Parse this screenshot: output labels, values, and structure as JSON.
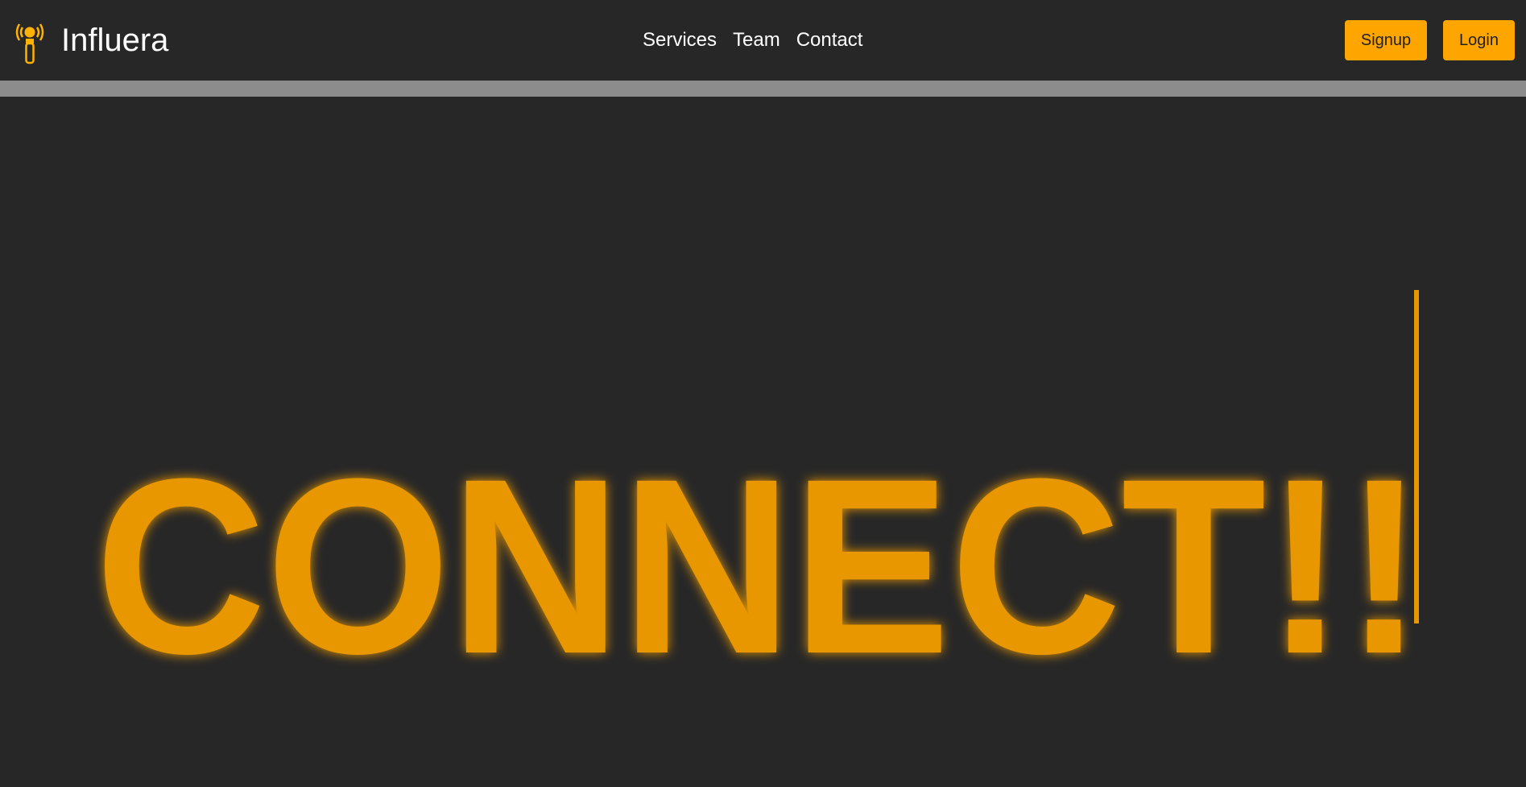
{
  "brand": {
    "name": "Influera",
    "icon": "signal-tower-icon"
  },
  "nav": {
    "links": [
      "Services",
      "Team",
      "Contact"
    ]
  },
  "auth": {
    "signup_label": "Signup",
    "login_label": "Login"
  },
  "hero": {
    "headline": "CONNECT!!"
  },
  "colors": {
    "background": "#272727",
    "accent": "#ffa500",
    "headline": "#e89700",
    "divider": "#8c8c8c",
    "text": "#ffffff"
  }
}
